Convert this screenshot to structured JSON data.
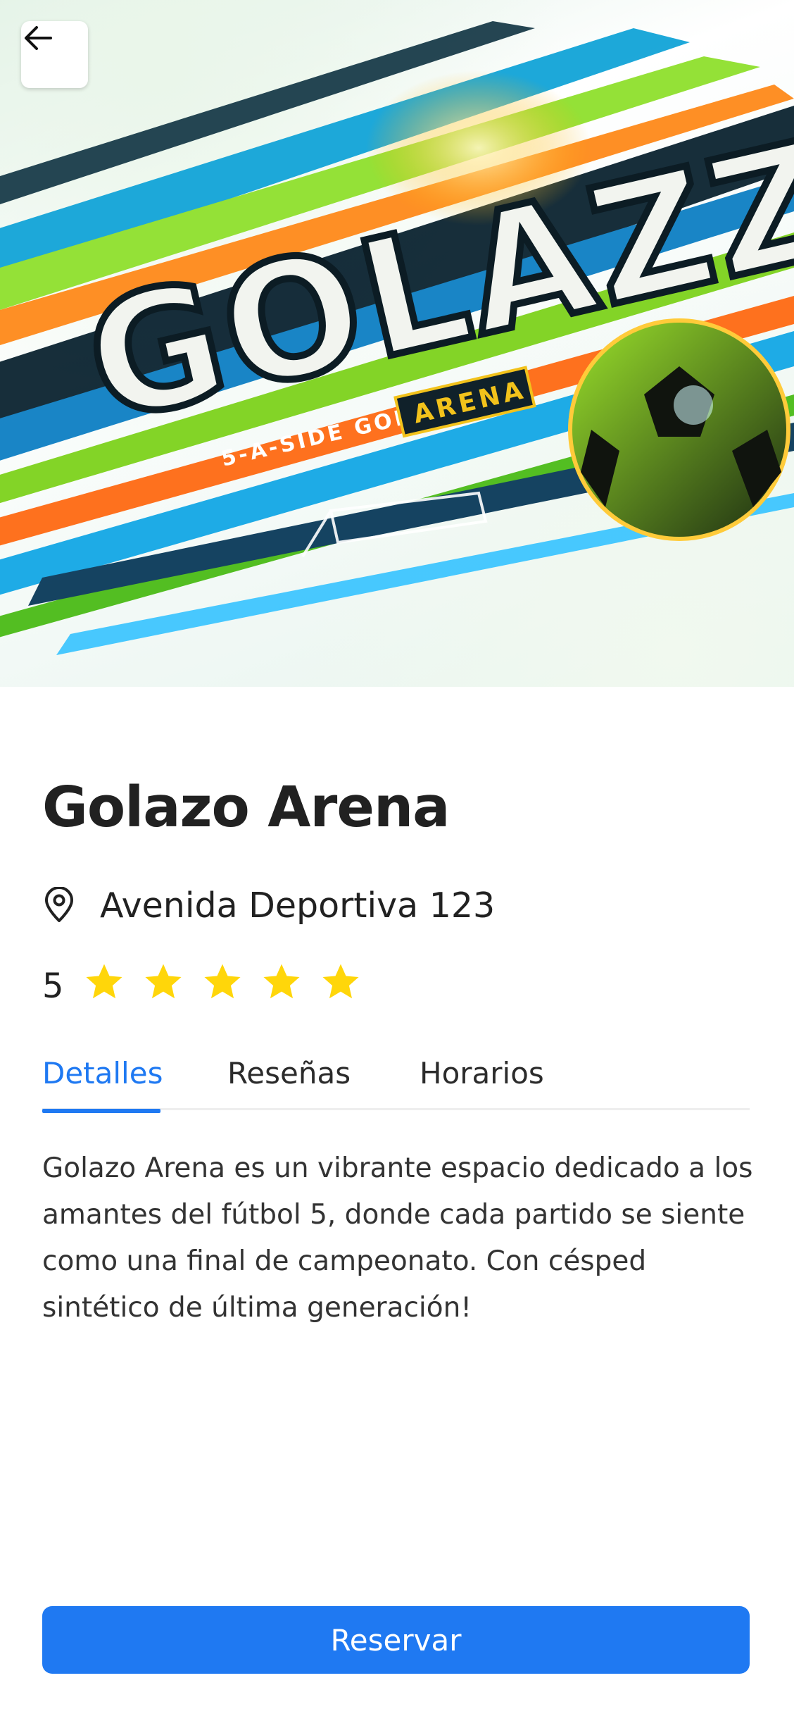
{
  "hero": {
    "logo_main": "GOLAZZ",
    "logo_tag": "5-A-SIDE GOLX",
    "logo_badge": "ARENA"
  },
  "venue": {
    "title": "Golazo Arena",
    "address": "Avenida Deportiva 123",
    "rating": "5",
    "rating_value": 5,
    "rating_max": 5,
    "description": "Golazo Arena es un vibrante espacio dedicado a los amantes del fútbol 5, donde cada partido se siente como una final de campeonato. Con césped sintético de última generación!"
  },
  "tabs": [
    {
      "label": "Detalles",
      "active": true
    },
    {
      "label": "Reseñas",
      "active": false
    },
    {
      "label": "Horarios",
      "active": false
    }
  ],
  "actions": {
    "reserve_label": "Reservar"
  },
  "icons": {
    "back": "arrow-left-icon",
    "location": "location-pin-icon",
    "star": "star-icon"
  },
  "colors": {
    "accent": "#1f79f2",
    "star": "#ffd60a",
    "text": "#212121"
  }
}
